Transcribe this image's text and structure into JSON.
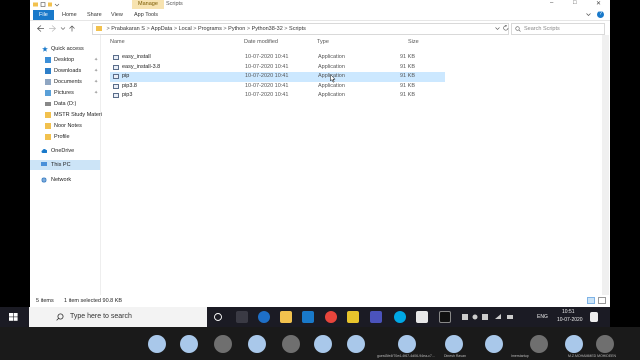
{
  "window": {
    "title": "Scripts",
    "ribbon_tabs": [
      "File",
      "Home",
      "Share",
      "View",
      "App Tools"
    ],
    "contextual_tab": "Manage",
    "controls": {
      "minimize": "–",
      "maximize": "□",
      "close": "✕",
      "help": "?"
    }
  },
  "address": {
    "crumbs": [
      "Prabakaran S",
      "AppData",
      "Local",
      "Programs",
      "Python",
      "Python38-32",
      "Scripts"
    ],
    "separator": ">",
    "search_placeholder": "Search Scripts"
  },
  "sidebar": {
    "items": [
      {
        "label": "Quick access",
        "icon": "star-icon",
        "pinned": false
      },
      {
        "label": "Desktop",
        "icon": "desktop-icon",
        "pinned": true
      },
      {
        "label": "Downloads",
        "icon": "download-icon",
        "pinned": true
      },
      {
        "label": "Documents",
        "icon": "documents-icon",
        "pinned": true
      },
      {
        "label": "Pictures",
        "icon": "pictures-icon",
        "pinned": true
      },
      {
        "label": "Data (D:)",
        "icon": "drive-icon",
        "pinned": false
      },
      {
        "label": "MSTR Study Materi",
        "icon": "folder-icon",
        "pinned": false
      },
      {
        "label": "Noor Notes",
        "icon": "folder-icon",
        "pinned": false
      },
      {
        "label": "Profile",
        "icon": "folder-icon",
        "pinned": false
      },
      {
        "label": "OneDrive",
        "icon": "cloud-icon",
        "pinned": false
      },
      {
        "label": "This PC",
        "icon": "computer-icon",
        "pinned": false,
        "selected": true
      },
      {
        "label": "Network",
        "icon": "network-icon",
        "pinned": false
      }
    ]
  },
  "table": {
    "columns": [
      "Name",
      "Date modified",
      "Type",
      "Size"
    ],
    "rows": [
      {
        "name": "easy_install",
        "date": "10-07-2020 10:41",
        "type": "Application",
        "size": "91 KB"
      },
      {
        "name": "easy_install-3.8",
        "date": "10-07-2020 10:41",
        "type": "Application",
        "size": "91 KB"
      },
      {
        "name": "pip",
        "date": "10-07-2020 10:41",
        "type": "Application",
        "size": "91 KB",
        "selected": true
      },
      {
        "name": "pip3.8",
        "date": "10-07-2020 10:41",
        "type": "Application",
        "size": "91 KB"
      },
      {
        "name": "pip3",
        "date": "10-07-2020 10:41",
        "type": "Application",
        "size": "91 KB"
      }
    ]
  },
  "status": {
    "items_count": "5 items",
    "selection": "1 item selected  90.8 KB"
  },
  "taskbar": {
    "search_placeholder": "Type here to search",
    "lang": "ENG",
    "time": "10:51",
    "date": "10-07-2020"
  },
  "meeting": {
    "participants": [
      "guest3fe4f70e4-4f67-4d06-94ea-c7...",
      "Dinesh Ravan",
      "Imerstartup",
      "M.Z.MOHAMMED MOHIDEEN"
    ]
  },
  "colors": {
    "accent": "#1979ca",
    "selection": "#cce8ff",
    "taskbar": "#1b1b24"
  }
}
